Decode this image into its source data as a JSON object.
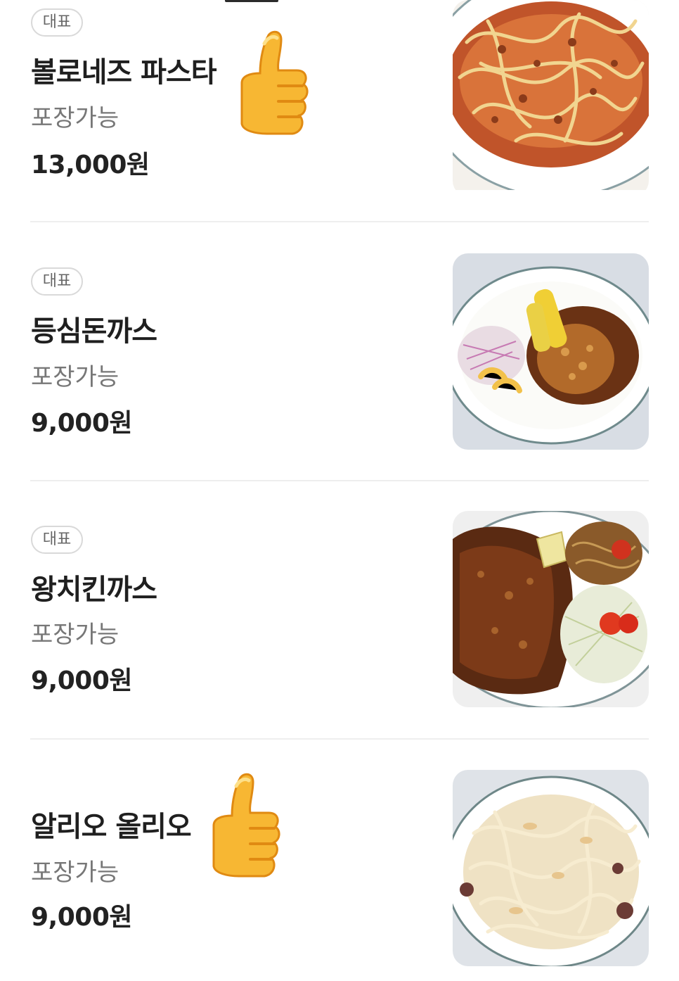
{
  "menu": {
    "items": [
      {
        "badge": "대표",
        "name": "볼로네즈 파스타",
        "status": "포장가능",
        "price": "13,000원",
        "photo_icon": "bolognese-pasta-photo",
        "thumbs_up": true
      },
      {
        "badge": "대표",
        "name": "등심돈까스",
        "status": "포장가능",
        "price": "9,000원",
        "photo_icon": "pork-cutlet-photo",
        "thumbs_up": false
      },
      {
        "badge": "대표",
        "name": "왕치킨까스",
        "status": "포장가능",
        "price": "9,000원",
        "photo_icon": "chicken-cutlet-photo",
        "thumbs_up": false
      },
      {
        "badge": "",
        "name": "알리오 올리오",
        "status": "포장가능",
        "price": "9,000원",
        "photo_icon": "aglio-olio-photo",
        "thumbs_up": true
      }
    ]
  },
  "colors": {
    "text_primary": "#1f1f1f",
    "text_secondary": "#777777",
    "badge_border": "#d9d9d9",
    "divider": "#eeeeee",
    "thumb_emoji": "#f6b23a"
  }
}
